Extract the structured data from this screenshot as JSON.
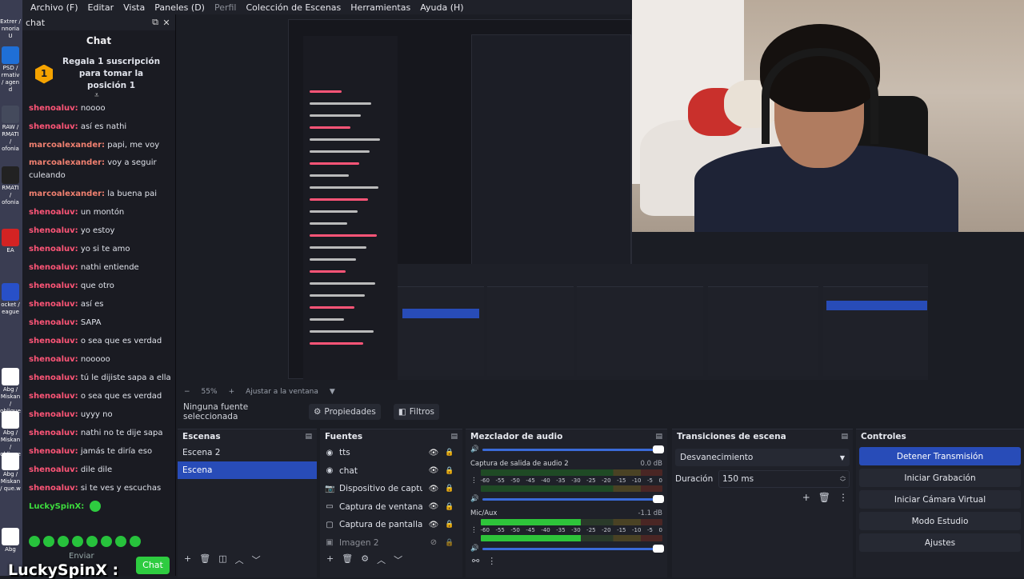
{
  "menu": [
    "Archivo (F)",
    "Editar",
    "Vista",
    "Paneles (D)",
    "Perfil",
    "Colección de Escenas",
    "Herramientas",
    "Ayuda (H)"
  ],
  "desktop_icons": [
    {
      "label": "Extrer / nnoria U",
      "color": "#3a3d52"
    },
    {
      "label": "PSD / rmativ / agen d",
      "color": "#1f6fd6"
    },
    {
      "label": "RAW / RMATI / ofonia",
      "color": "#444a5c"
    },
    {
      "label": "RMATI / ofonia",
      "color": "#222"
    },
    {
      "label": "EA",
      "color": "#d32323"
    },
    {
      "label": "ocket / eague",
      "color": "#2850c8"
    },
    {
      "label": "Abg / Miskan / oblique",
      "color": "#ffffff"
    },
    {
      "label": "Abg / Miskan / oblique",
      "color": "#ffffff"
    },
    {
      "label": "Abg / Miskan / que.w",
      "color": "#ffffff"
    },
    {
      "label": "Abg",
      "color": "#ffffff"
    }
  ],
  "chat": {
    "dock_title": "chat",
    "title": "Chat",
    "gift_text": "Regala 1 suscripción para tomar la posición 1",
    "messages": [
      {
        "user": "shenoaluv:",
        "text": "noooo",
        "color": "#ff5577"
      },
      {
        "user": "shenoaluv:",
        "text": "así es nathi",
        "color": "#ff5577"
      },
      {
        "user": "marcoalexander:",
        "text": "papi, me voy",
        "color": "#f08070"
      },
      {
        "user": "marcoalexander:",
        "text": "voy a seguir culeando",
        "color": "#f08070",
        "wrap": true
      },
      {
        "user": "marcoalexander:",
        "text": "la buena pai",
        "color": "#f08070"
      },
      {
        "user": "shenoaluv:",
        "text": "un montón",
        "color": "#ff5577"
      },
      {
        "user": "shenoaluv:",
        "text": "yo estoy",
        "color": "#ff5577"
      },
      {
        "user": "shenoaluv:",
        "text": "yo si te amo",
        "color": "#ff5577"
      },
      {
        "user": "shenoaluv:",
        "text": "nathi entiende",
        "color": "#ff5577"
      },
      {
        "user": "shenoaluv:",
        "text": "que otro",
        "color": "#ff5577"
      },
      {
        "user": "shenoaluv:",
        "text": "así es",
        "color": "#ff5577"
      },
      {
        "user": "shenoaluv:",
        "text": "SAPA",
        "color": "#ff5577"
      },
      {
        "user": "shenoaluv:",
        "text": "o sea que es verdad",
        "color": "#ff5577"
      },
      {
        "user": "shenoaluv:",
        "text": "nooooo",
        "color": "#ff5577"
      },
      {
        "user": "shenoaluv:",
        "text": "tú le dijiste sapa a ella",
        "color": "#ff5577"
      },
      {
        "user": "shenoaluv:",
        "text": "o sea que es verdad",
        "color": "#ff5577"
      },
      {
        "user": "shenoaluv:",
        "text": "uyyy no",
        "color": "#ff5577"
      },
      {
        "user": "shenoaluv:",
        "text": "nathi no te dije sapa",
        "color": "#ff5577"
      },
      {
        "user": "shenoaluv:",
        "text": "jamás te diría eso",
        "color": "#ff5577"
      },
      {
        "user": "shenoaluv:",
        "text": "dile dile",
        "color": "#ff5577"
      },
      {
        "user": "shenoaluv:",
        "text": "si te ves y escuchas",
        "color": "#ff5577"
      },
      {
        "user": "LuckySpinX:",
        "text": "",
        "color": "#3ddc3d"
      }
    ],
    "send_label": "Enviar",
    "chat_button": "Chat",
    "overlay_name": "LuckySpinX :"
  },
  "preview_toolbar": {
    "zoom": "55%",
    "fit": "Ajustar a la ventana"
  },
  "source_bar": {
    "none": "Ninguna fuente seleccionada",
    "props": "Propiedades",
    "filters": "Filtros"
  },
  "scenes": {
    "title": "Escenas",
    "items": [
      "Escena 2",
      "Escena"
    ],
    "selected": 1
  },
  "sources": {
    "title": "Fuentes",
    "items": [
      {
        "icon": "tts-icon",
        "glyph": "◉",
        "name": "tts",
        "visible": true
      },
      {
        "icon": "chat-icon",
        "glyph": "◉",
        "name": "chat",
        "visible": true
      },
      {
        "icon": "camera-icon",
        "glyph": "📷",
        "name": "Dispositivo de captura",
        "visible": true
      },
      {
        "icon": "window-icon",
        "glyph": "▭",
        "name": "Captura de ventana",
        "visible": true
      },
      {
        "icon": "monitor-icon",
        "glyph": "▢",
        "name": "Captura de pantalla",
        "visible": true
      },
      {
        "icon": "image-icon",
        "glyph": "▣",
        "name": "Imagen 2",
        "visible": false
      }
    ]
  },
  "mixer": {
    "title": "Mezclador de audio",
    "channels": [
      {
        "name": "Captura de salida de audio 2",
        "db": "0.0 dB",
        "level": 0.0
      },
      {
        "name": "Mic/Aux",
        "db": "-1.1 dB",
        "level": 0.55
      }
    ],
    "scale": [
      "-60",
      "-55",
      "-50",
      "-45",
      "-40",
      "-35",
      "-30",
      "-25",
      "-20",
      "-15",
      "-10",
      "-5",
      "0"
    ]
  },
  "transitions": {
    "title": "Transiciones de escena",
    "selected": "Desvanecimiento",
    "duration_label": "Duración",
    "duration": "150 ms"
  },
  "controls": {
    "title": "Controles",
    "buttons": [
      "Detener Transmisión",
      "Iniciar Grabación",
      "Iniciar Cámara Virtual",
      "Modo Estudio",
      "Ajustes"
    ]
  },
  "colors": {
    "accent": "#284cb8",
    "green": "#2ecc40",
    "meter_green": "#2ec43a",
    "meter_yellow": "#c8a02a",
    "meter_red": "#b8302a"
  }
}
